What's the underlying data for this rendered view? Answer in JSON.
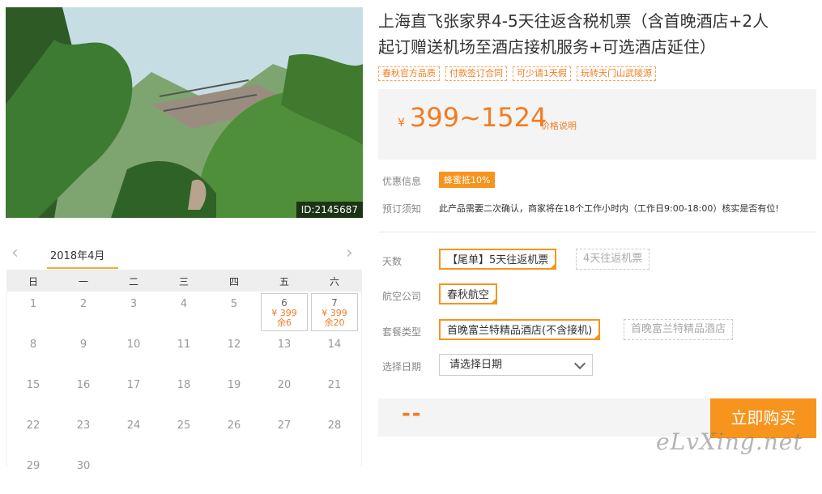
{
  "photo": {
    "id_label": "ID:2145687"
  },
  "calendar": {
    "month": "2018年4月",
    "weekdays": [
      "日",
      "一",
      "二",
      "三",
      "四",
      "五",
      "六"
    ],
    "rows": [
      [
        "1",
        "2",
        "3",
        "4",
        "5",
        "6",
        "7"
      ],
      [
        "8",
        "9",
        "10",
        "11",
        "12",
        "13",
        "14"
      ],
      [
        "15",
        "16",
        "17",
        "18",
        "19",
        "20",
        "21"
      ],
      [
        "22",
        "23",
        "24",
        "25",
        "26",
        "27",
        "28"
      ],
      [
        "29",
        "30",
        "",
        "",
        "",
        "",
        ""
      ]
    ],
    "avail": {
      "d6": {
        "price": "¥ 399",
        "remain": "余6"
      },
      "d7": {
        "price": "¥ 399",
        "remain": "余20"
      }
    }
  },
  "product": {
    "title_line1": "上海直飞张家界4-5天往返含税机票（含首晚酒店+2人",
    "title_line2": "起订赠送机场至酒店接机服务+可选酒店延住）",
    "tags": [
      "春秋官方品质",
      "付款签订合同",
      "可少请1天假",
      "玩转天门山武陵源"
    ]
  },
  "price": {
    "currency": "¥",
    "range": "399~1524",
    "link": "价格说明"
  },
  "info": {
    "promo_label": "优惠信息",
    "promo_badge": "蜂蜜抵10%",
    "notice_label": "预订须知",
    "notice_text": "此产品需要二次确认，商家将在18个工作小时内（工作日9:00-18:00）核实是否有位!"
  },
  "options": {
    "days_label": "天数",
    "days": [
      "【尾单】5天往返机票",
      "4天往返机票"
    ],
    "airline_label": "航空公司",
    "airline": [
      "春秋航空"
    ],
    "package_label": "套餐类型",
    "package": [
      "首晚富兰特精品酒店(不含接机)",
      "首晚富兰特精品酒店"
    ],
    "date_label": "选择日期",
    "date_placeholder": "请选择日期"
  },
  "buy": {
    "total": "--",
    "button": "立即购买"
  },
  "watermark": "eLvXing.net",
  "colors": {
    "accent": "#f7941d",
    "price": "#f47b20"
  }
}
